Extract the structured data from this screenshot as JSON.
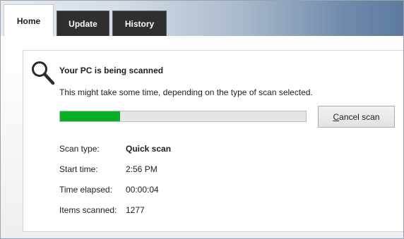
{
  "tabs": [
    {
      "label": "Home",
      "active": true
    },
    {
      "label": "Update",
      "active": false
    },
    {
      "label": "History",
      "active": false
    }
  ],
  "scan": {
    "title": "Your PC is being scanned",
    "description": "This might take some time, depending on the type of scan selected.",
    "progress_fraction": 0.245,
    "progress_color": "#06b025",
    "cancel_button": {
      "mnemonic": "C",
      "rest": "ancel scan"
    }
  },
  "details": [
    {
      "label": "Scan type:",
      "value": "Quick scan",
      "emphasis": true
    },
    {
      "label": "Start time:",
      "value": "2:56 PM",
      "emphasis": false
    },
    {
      "label": "Time elapsed:",
      "value": "00:00:04",
      "emphasis": false
    },
    {
      "label": "Items scanned:",
      "value": "1277",
      "emphasis": false
    }
  ],
  "icons": {
    "scan_status": "search-icon"
  }
}
